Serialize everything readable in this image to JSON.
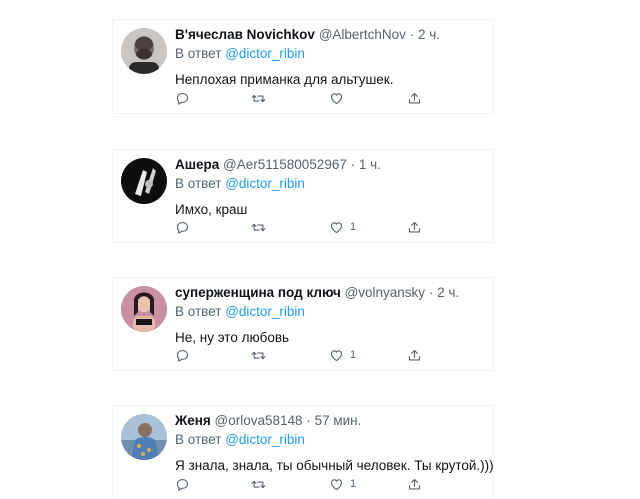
{
  "tweets": [
    {
      "display_name": "В'ячеслав Novichkov",
      "handle": "@AlbertchNov",
      "dot": "·",
      "time": "2 ч.",
      "reply_prefix": "В ответ",
      "reply_handle": "@dictor_ribin",
      "text": "Неплохая приманка для альтушек.",
      "like_count": ""
    },
    {
      "display_name": "Ашера",
      "handle": "@Aer511580052967",
      "dot": "·",
      "time": "1 ч.",
      "reply_prefix": "В ответ",
      "reply_handle": "@dictor_ribin",
      "text": "Имхо, краш",
      "like_count": "1"
    },
    {
      "display_name": "суперженщина под ключ",
      "handle": "@volnyansky",
      "dot": "·",
      "time": "2 ч.",
      "reply_prefix": "В ответ",
      "reply_handle": "@dictor_ribin",
      "text": "Не, ну это любовь",
      "like_count": "1"
    },
    {
      "display_name": "Женя",
      "handle": "@orlova58148",
      "dot": "·",
      "time": "57 мин.",
      "reply_prefix": "В ответ",
      "reply_handle": "@dictor_ribin",
      "text": "Я знала, знала, ты обычный человек. Ты крутой.)))",
      "like_count": "1"
    }
  ],
  "colors": {
    "link": "#1d9bf0",
    "muted": "#536471",
    "text": "#0f1419"
  },
  "icons": [
    "reply-icon",
    "retweet-icon",
    "like-icon",
    "share-icon"
  ]
}
